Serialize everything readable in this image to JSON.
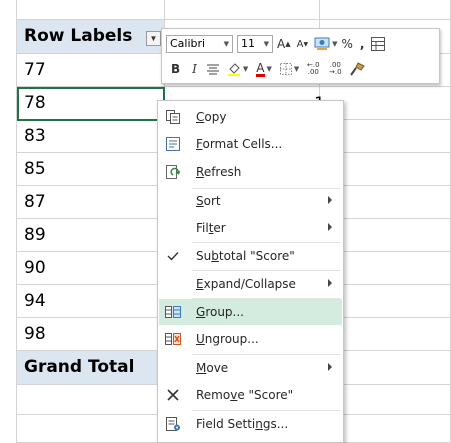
{
  "pivot": {
    "header": "Row Labels",
    "rows": [
      "77",
      "78",
      "83",
      "85",
      "87",
      "89",
      "90",
      "94",
      "98"
    ],
    "grand_total": "Grand Total",
    "peek_value": "1"
  },
  "mini_toolbar": {
    "font_name": "Calibri",
    "font_size": "11",
    "grow_font": "A",
    "shrink_font": "A",
    "percent": "%",
    "comma": ",",
    "bold": "B",
    "italic": "I",
    "font_color": "A",
    "increase_decimal": "←.0 .00",
    "decrease_decimal": ".00 →.0"
  },
  "context_menu": {
    "items": [
      {
        "pre": "",
        "key": "C",
        "post": "opy",
        "icon": "copy-icon"
      },
      {
        "pre": "",
        "key": "F",
        "post": "ormat Cells...",
        "icon": "format-cells-icon"
      },
      {
        "pre": "",
        "key": "R",
        "post": "efresh",
        "icon": "refresh-icon"
      },
      {
        "pre": "",
        "key": "S",
        "post": "ort",
        "icon": ""
      },
      {
        "pre": "Fil",
        "key": "t",
        "post": "er",
        "icon": ""
      },
      {
        "pre": "Su",
        "key": "b",
        "post": "total \"Score\"",
        "icon": "check-icon"
      },
      {
        "pre": "",
        "key": "E",
        "post": "xpand/Collapse",
        "icon": ""
      },
      {
        "pre": "",
        "key": "G",
        "post": "roup...",
        "icon": "group-icon"
      },
      {
        "pre": "",
        "key": "U",
        "post": "ngroup...",
        "icon": "ungroup-icon"
      },
      {
        "pre": "",
        "key": "M",
        "post": "ove",
        "icon": ""
      },
      {
        "pre": "Remo",
        "key": "v",
        "post": "e \"Score\"",
        "icon": "remove-icon"
      },
      {
        "pre": "Field Setti",
        "key": "n",
        "post": "gs...",
        "icon": "field-settings-icon"
      }
    ]
  },
  "colors": {
    "accent": "#217346",
    "header_fill": "#dce6f1",
    "highlight": "#d3ecdf"
  }
}
